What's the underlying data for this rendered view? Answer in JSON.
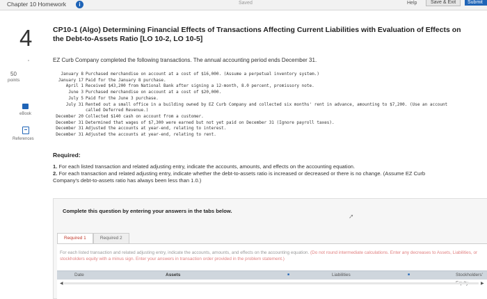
{
  "header": {
    "homework_title": "Chapter 10 Homework",
    "info_icon": "info-icon",
    "saved_label": "Saved",
    "help_label": "Help",
    "save_exit_label": "Save & Exit",
    "submit_label": "Submit"
  },
  "sidebar": {
    "question_number": "4",
    "points_value": "50",
    "points_label": "points",
    "ebook_label": "eBook",
    "references_label": "References"
  },
  "question": {
    "title": "CP10-1 (Algo) Determining Financial Effects of Transactions Affecting Current Liabilities with Evaluation of Effects on the Debt-to-Assets Ratio [LO 10-2, LO 10-5]",
    "intro": "EZ Curb Company completed the following transactions. The annual accounting period ends December 31.",
    "transactions": [
      {
        "date": "January 8",
        "desc": "Purchased merchandise on account at a cost of $16,000. (Assume a perpetual inventory system.)"
      },
      {
        "date": "January 17",
        "desc": "Paid for the January 8 purchase."
      },
      {
        "date": "April 1",
        "desc": "Received $43,200 from National Bank after signing a 12-month, 8.0 percent, promissory note."
      },
      {
        "date": "June 3",
        "desc": "Purchased merchandise on account at a cost of $20,000."
      },
      {
        "date": "July 5",
        "desc": "Paid for the June 3 purchase."
      },
      {
        "date": "July 31",
        "desc": "Rented out a small office in a building owned by EZ Curb Company and collected six months' rent in advance, amounting to $7,200. (Use an account called Deferred Revenue.)"
      },
      {
        "date": "December 20",
        "desc": "Collected $140 cash on account from a customer."
      },
      {
        "date": "December 31",
        "desc": "Determined that wages of $7,300 were earned but not yet paid on December 31 (Ignore payroll taxes)."
      },
      {
        "date": "December 31",
        "desc": "Adjusted the accounts at year-end, relating to interest."
      },
      {
        "date": "December 31",
        "desc": "Adjusted the accounts at year-end, relating to rent."
      }
    ],
    "required_heading": "Required:",
    "required_items": [
      {
        "num": "1.",
        "text": "For each listed transaction and related adjusting entry, indicate the accounts, amounts, and effects on the accounting equation."
      },
      {
        "num": "2.",
        "text": "For each transaction and related adjusting entry, indicate whether the debt-to-assets ratio is increased or decreased or there is no change. (Assume EZ Curb Company's debt-to-assets ratio has always been less than 1.0.)"
      }
    ]
  },
  "answer_panel": {
    "complete_text": "Complete this question by entering your answers in the tabs below.",
    "tabs": [
      "Required 1",
      "Required 2"
    ],
    "instructions_main": "For each listed transaction and related adjusting entry, indicate the accounts, amounts, and effects on the accounting equation.",
    "instructions_red": "(Do not round intermediate calculations. Enter any decreases to Assets, Liabilities, or stockholders equity with a minus sign. Enter your answers in transaction order provided in the problem statement.)",
    "table_headers": {
      "date": "Date",
      "assets": "Assets",
      "liabilities": "Liabilities",
      "stockholders": "Stockholders' Equity"
    }
  }
}
